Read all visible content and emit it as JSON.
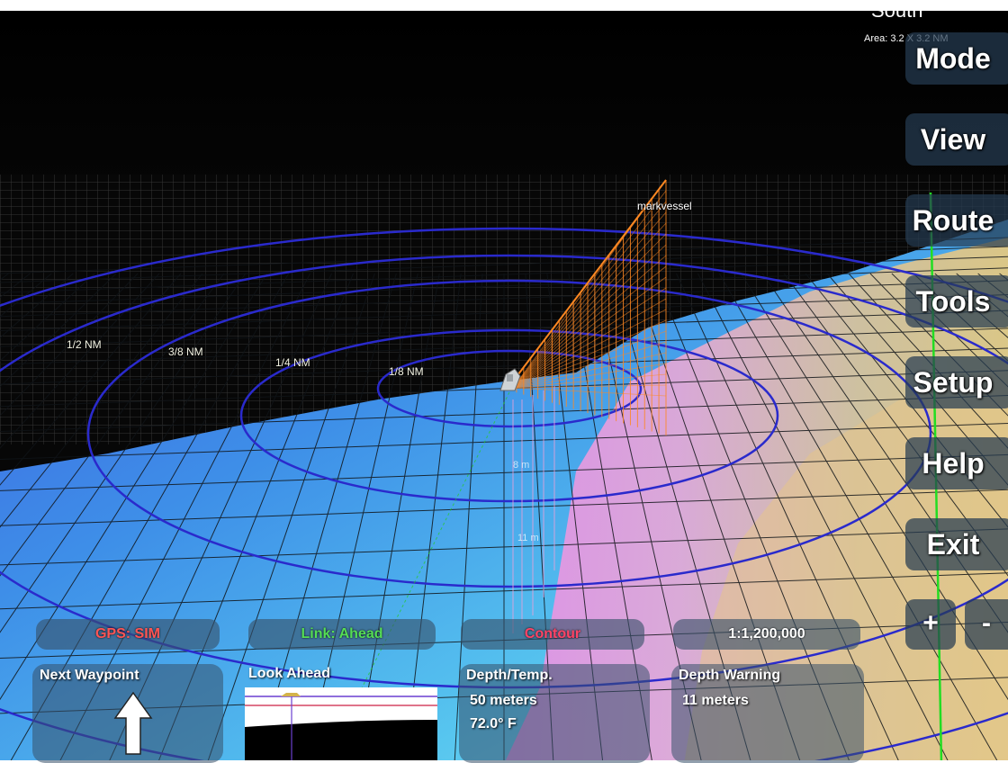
{
  "compass": {
    "heading": "South",
    "area": "Area: 3.2 X 3.2 NM"
  },
  "menu": [
    "Mode",
    "View",
    "Route",
    "Tools",
    "Setup",
    "Help",
    "Exit"
  ],
  "zoom": {
    "in": "+",
    "out": "-"
  },
  "status": {
    "gps": "GPS: SIM",
    "link": "Link: Ahead",
    "layer": "Contour",
    "scale": "1:1,200,000"
  },
  "colors": {
    "gps": "#ff5555",
    "link": "#55dd55",
    "layer": "#ff4466",
    "scale": "#ffffff",
    "range_ring": "#2a2acc",
    "route_line": "#22cc22",
    "vessel_trail": "#ff8822"
  },
  "panels": {
    "next_waypoint": {
      "title": "Next Waypoint",
      "icon": "up-arrow-icon"
    },
    "look_ahead": {
      "title": "Look  Ahead"
    },
    "depth_temp": {
      "title": "Depth/Temp.",
      "depth": "50 meters",
      "temp": "72.0° F"
    },
    "depth_warning": {
      "title": "Depth Warning",
      "value": "11 meters"
    }
  },
  "map": {
    "range_rings": [
      "1/2 NM",
      "3/8 NM",
      "1/4 NM",
      "1/8 NM"
    ],
    "vessel_label": "markvessel"
  }
}
